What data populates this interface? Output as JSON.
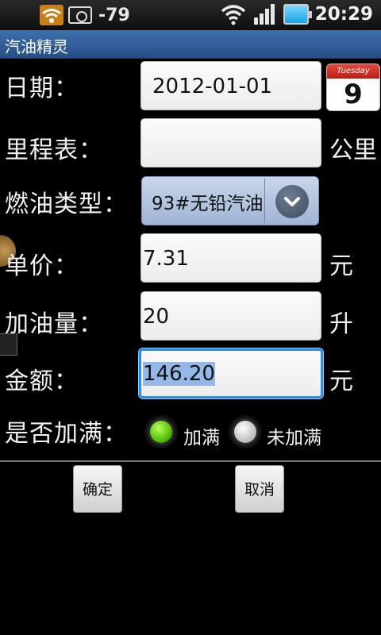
{
  "status_bar": {
    "signal_value": "-79",
    "time": "20:29",
    "icons": [
      "wifi-alert-icon",
      "camera-icon",
      "wifi-icon",
      "signal-bars-icon",
      "battery-icon"
    ]
  },
  "app_title": "汽油精灵",
  "form": {
    "date": {
      "label": "日期：",
      "value": "2012-01-01",
      "calendar_weekday": "Tuesday",
      "calendar_day": "9"
    },
    "odometer": {
      "label": "里程表：",
      "value": "",
      "unit": "公里"
    },
    "fuel_type": {
      "label": "燃油类型：",
      "selected": "93#无铅汽油"
    },
    "unit_price": {
      "label": "单价：",
      "value": "7.31",
      "unit": "元"
    },
    "fuel_amount": {
      "label": "加油量：",
      "value": "20",
      "unit": "升"
    },
    "total": {
      "label": "金额：",
      "value": "146.20",
      "unit": "元"
    },
    "full_tank": {
      "label": "是否加满：",
      "options": [
        {
          "label": "加满",
          "selected": true
        },
        {
          "label": "未加满",
          "selected": false
        }
      ]
    }
  },
  "buttons": {
    "confirm": "确定",
    "cancel": "取消"
  },
  "colors": {
    "title_bar": "#2f5c99",
    "focus_border": "#2e8ee0",
    "radio_selected": "#5cd10a"
  }
}
